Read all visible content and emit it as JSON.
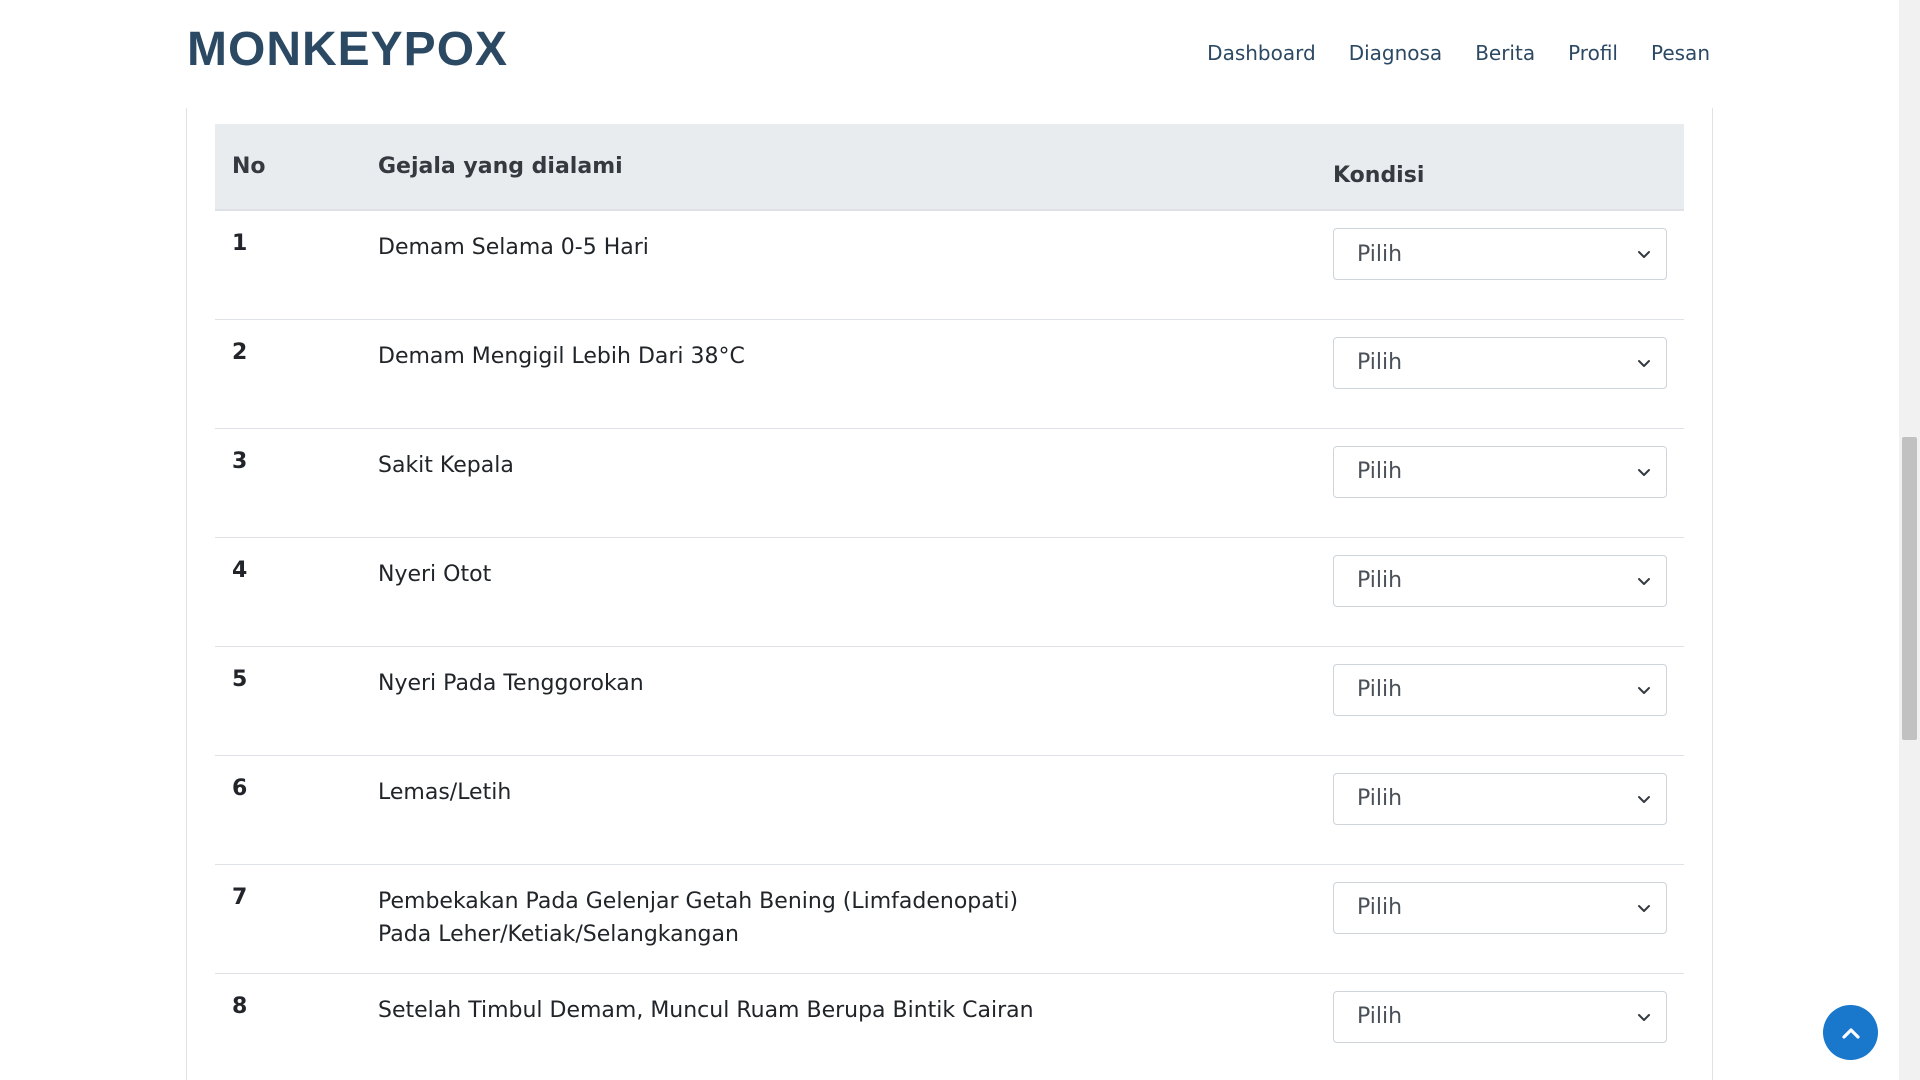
{
  "header": {
    "logo": "MONKEYPOX",
    "nav": [
      "Dashboard",
      "Diagnosa",
      "Berita",
      "Profil",
      "Pesan"
    ]
  },
  "table": {
    "headers": {
      "no": "No",
      "gejala": "Gejala yang dialami",
      "kondisi": "Kondisi"
    },
    "rows": [
      {
        "no": "1",
        "gejala": "Demam Selama 0-5 Hari",
        "kondisi": "Pilih"
      },
      {
        "no": "2",
        "gejala": "Demam Mengigil Lebih Dari 38°C",
        "kondisi": "Pilih"
      },
      {
        "no": "3",
        "gejala": "Sakit Kepala",
        "kondisi": "Pilih"
      },
      {
        "no": "4",
        "gejala": "Nyeri Otot",
        "kondisi": "Pilih"
      },
      {
        "no": "5",
        "gejala": "Nyeri Pada Tenggorokan",
        "kondisi": "Pilih"
      },
      {
        "no": "6",
        "gejala": "Lemas/Letih",
        "kondisi": "Pilih"
      },
      {
        "no": "7",
        "gejala": "Pembekakan Pada Gelenjar Getah Bening (Limfadenopati) Pada Leher/Ketiak/Selangkangan",
        "kondisi": "Pilih"
      },
      {
        "no": "8",
        "gejala": "Setelah Timbul Demam, Muncul Ruam Berupa Bintik Cairan",
        "kondisi": "Pilih"
      }
    ]
  },
  "icons": {
    "select_chevron": "chevron-down-icon",
    "back_to_top": "chevron-up-icon"
  },
  "colors": {
    "brand": "#2c4964",
    "accent": "#1977cc",
    "header_bg": "#e9ecef"
  }
}
